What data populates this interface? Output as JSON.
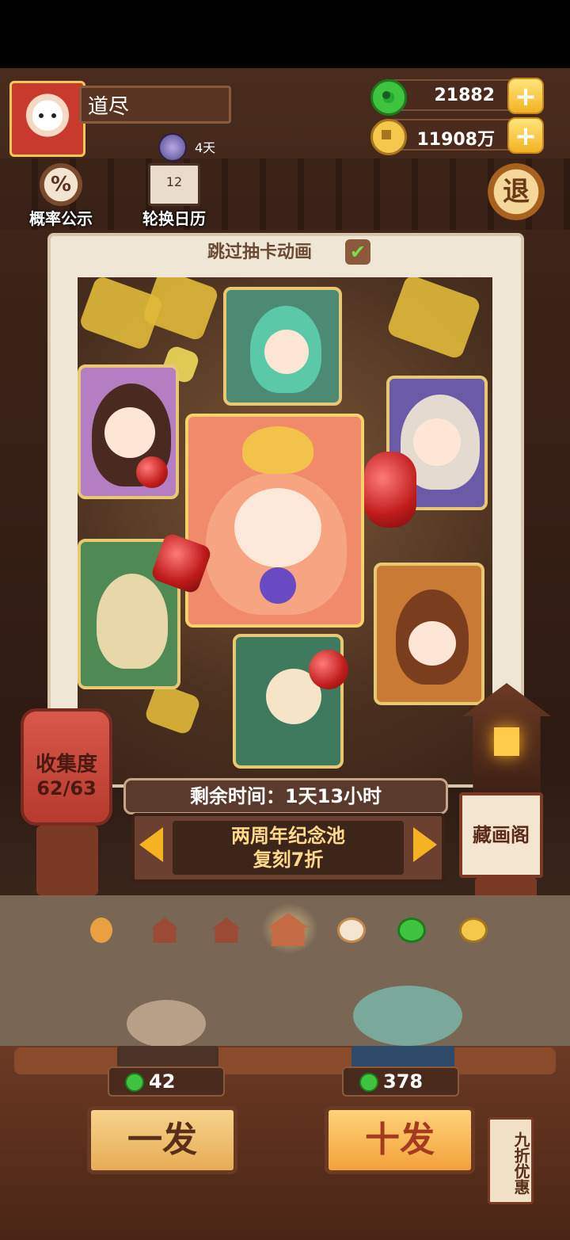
{
  "player": {
    "name": "道尽",
    "days": "4天"
  },
  "resources": {
    "jade": "21882",
    "coins": "11908万",
    "plus": "+"
  },
  "tools": {
    "probability": "概率公示",
    "probability_icon": "%",
    "calendar": "轮换日历",
    "calendar_icon": "12",
    "exit": "退"
  },
  "gacha": {
    "skip_label": "跳过抽卡动画",
    "skip_checked": true,
    "check_mark": "✔"
  },
  "collection": {
    "label": "收集度",
    "value": "62/63"
  },
  "pool": {
    "timer": "剩余时间：1天13小时",
    "name": "两周年纪念池",
    "discount": "复刻7折"
  },
  "gallery": {
    "label": "藏画阁"
  },
  "tabs": [
    "lantern",
    "house",
    "house",
    "house-active",
    "plus-coin",
    "jade",
    "coin"
  ],
  "draw": {
    "single_label": "一发",
    "single_cost": "42",
    "ten_label": "十发",
    "ten_cost": "378",
    "discount_tag": "九折优惠"
  },
  "colors": {
    "accent": "#f3b322",
    "jade": "#3ec43e",
    "wood": "#4a2a1c"
  }
}
